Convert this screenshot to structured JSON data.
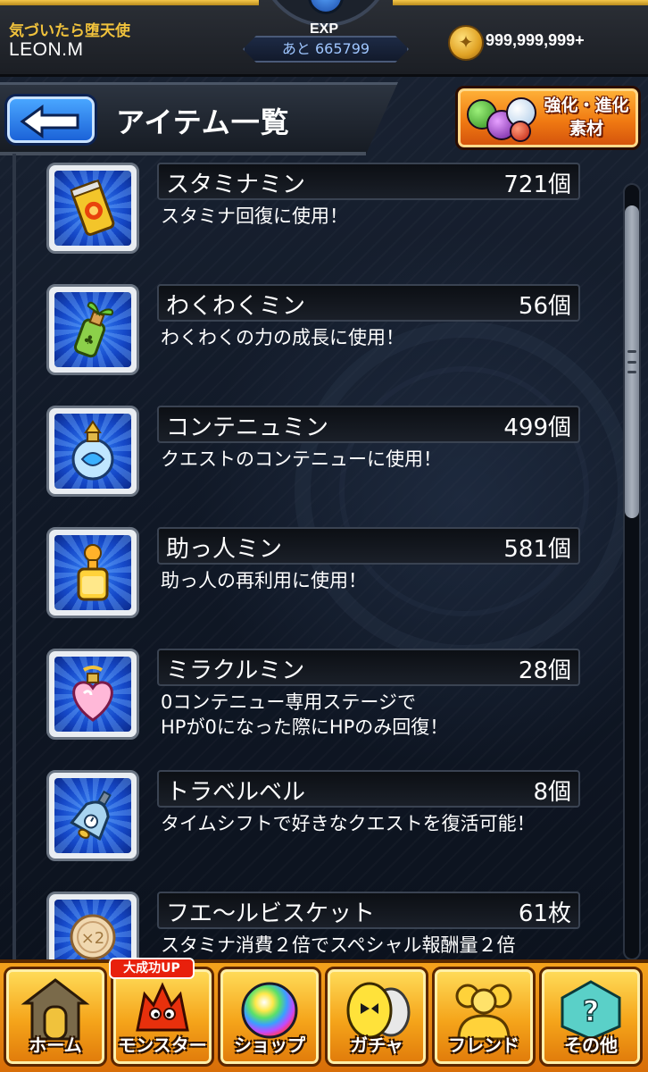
{
  "status": {
    "title": "気づいたら堕天使",
    "player_name": "LEON.M",
    "exp_label": "EXP",
    "exp_remaining": "あと 665799",
    "coins": "999,999,999+"
  },
  "header": {
    "page_title": "アイテム一覧",
    "material_button_label": "強化・進化 素材"
  },
  "items": [
    {
      "name": "スタミナミン",
      "count": "721個",
      "description": "スタミナ回復に使用！",
      "icon": "stamina-can-icon"
    },
    {
      "name": "わくわくミン",
      "count": "56個",
      "description": "わくわくの力の成長に使用！",
      "icon": "sprout-bottle-icon"
    },
    {
      "name": "コンテニュミン",
      "count": "499個",
      "description": "クエストのコンテニューに使用！",
      "icon": "continue-flask-icon"
    },
    {
      "name": "助っ人ミン",
      "count": "581個",
      "description": "助っ人の再利用に使用！",
      "icon": "helper-bottle-icon"
    },
    {
      "name": "ミラクルミン",
      "count": "28個",
      "description": "0コンテニュー専用ステージで\nHPが0になった際にHPのみ回復！",
      "icon": "heart-potion-icon"
    },
    {
      "name": "トラベルベル",
      "count": "8個",
      "description": "タイムシフトで好きなクエストを復活可能！",
      "icon": "travel-bell-icon"
    },
    {
      "name": "フエ～ルビスケット",
      "count": "61枚",
      "description": "スタミナ消費２倍でスペシャル報酬量２倍",
      "icon": "biscuit-icon"
    }
  ],
  "nav": {
    "badge": "大成功UP",
    "home": "ホーム",
    "monster": "モンスター",
    "shop": "ショップ",
    "gacha": "ガチャ",
    "friend": "フレンド",
    "other": "その他"
  },
  "colors": {
    "accent_gold": "#f0c23c",
    "back_button_blue": "#1c63d8",
    "nav_orange": "#f5a41a",
    "exp_text": "#9fc6ff"
  }
}
